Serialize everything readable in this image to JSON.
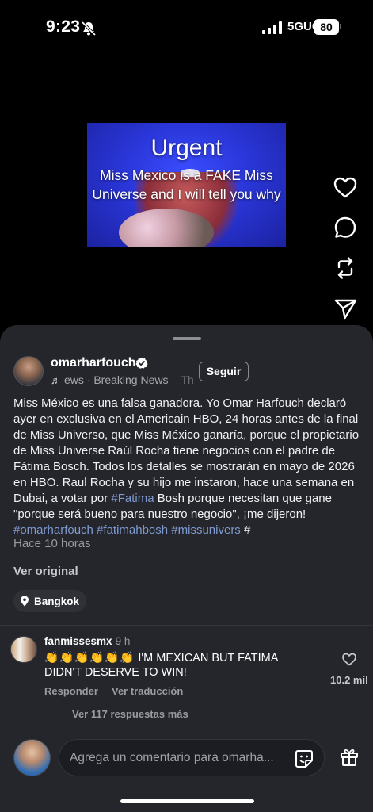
{
  "status_bar": {
    "time": "9:23",
    "network": "5GUC",
    "battery": "80"
  },
  "video": {
    "headline": "Urgent",
    "line1": "Miss Mexico is a FAKE Miss",
    "line2": "Universe and I will tell you why"
  },
  "side_actions": [
    "heart-icon",
    "comment-icon",
    "repost-icon",
    "share-icon"
  ],
  "post": {
    "username": "omarharfouch",
    "music": "ews · Breaking News",
    "music_suffix": "Th",
    "follow_label": "Seguir",
    "caption": "Miss México es una falsa ganadora. Yo Omar Harfouch declaró ayer en exclusiva en el Americain HBO, 24 horas antes de la final de Miss Universo, que Miss México ganaría, porque el propietario de Miss Universe Raúl Rocha tiene negocios con el padre de Fátima Bosch. Todos los detalles se mostrarán en mayo de 2026 en HBO. Raul Rocha y su hijo me instaron, hace una semana en Dubai, a votar por",
    "tag_inline": "#Fatima",
    "caption_tail": "Bosh porque necesitan que gane \"porque será bueno para nuestro negocio\", ¡me dijeron!",
    "hashtags": "#omarharfouch #fatimahbosh #missunivers",
    "trailing_hash": "#",
    "time_ago": "Hace 10 horas",
    "see_original": "Ver original",
    "location": "Bangkok"
  },
  "comment": {
    "user": "fanmissesmx",
    "time": "9 h",
    "claps": "👏👏👏👏👏👏",
    "text": "I'M MEXICAN BUT FATIMA DIDN'T DESERVE TO WIN!",
    "reply": "Responder",
    "translate": "Ver traducción",
    "likes": "10.2 mil",
    "replies": "Ver 117 respuestas más"
  },
  "composer": {
    "placeholder": "Agrega un comentario para omarha..."
  }
}
